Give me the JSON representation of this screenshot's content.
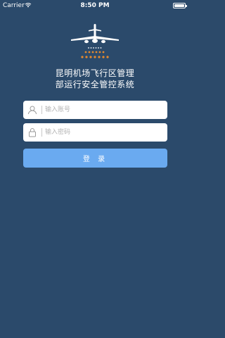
{
  "status_bar": {
    "carrier": "Carrier",
    "time": "8:50 PM",
    "wifi_icon": "wifi-icon",
    "battery_icon": "battery-full-icon"
  },
  "logo": {
    "icon": "airplane-runway-lights-icon",
    "light_color": "#e58a2e"
  },
  "title": {
    "line1": "昆明机场飞行区管理",
    "line2": "部运行安全管控系统"
  },
  "form": {
    "account_placeholder": "输入账号",
    "account_icon": "user-icon",
    "password_placeholder": "输入密码",
    "password_icon": "lock-icon",
    "login_label": "登 录"
  },
  "colors": {
    "background": "#2b4a6b",
    "button": "#6aaaf0"
  }
}
